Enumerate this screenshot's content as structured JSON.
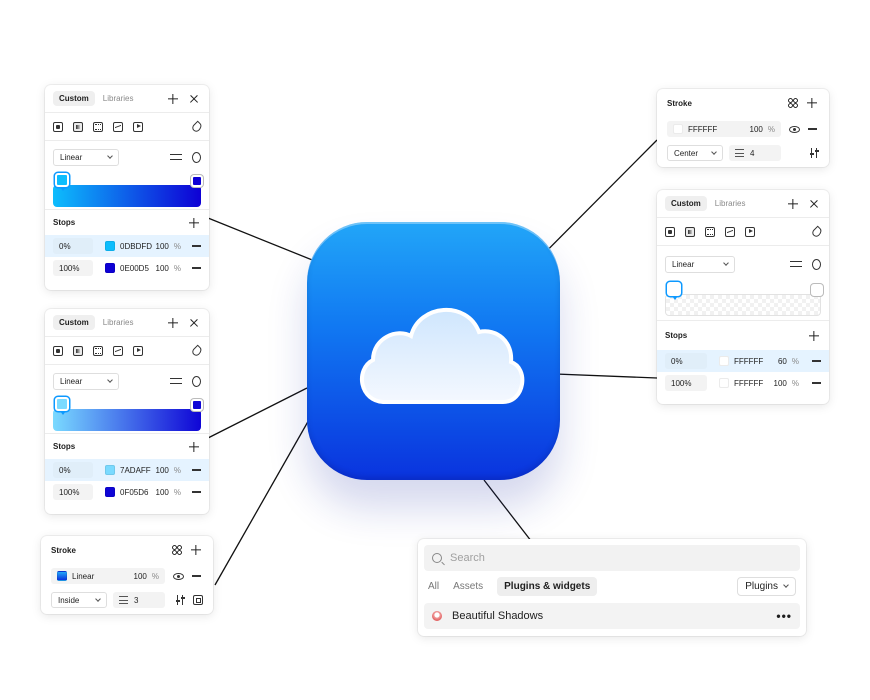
{
  "panel_fill_top": {
    "tabs": [
      "Custom",
      "Libraries"
    ],
    "type": "Linear",
    "stops_label": "Stops",
    "stops": [
      {
        "pos": "0%",
        "hex": "0DBDFD",
        "color": "#0DBDFD",
        "opacity": "100",
        "unit": "%"
      },
      {
        "pos": "100%",
        "hex": "0E00D5",
        "color": "#0E00D5",
        "opacity": "100",
        "unit": "%"
      }
    ],
    "gradient": [
      "#0DBDFD",
      "#0E00D5"
    ]
  },
  "panel_fill_mid": {
    "tabs": [
      "Custom",
      "Libraries"
    ],
    "type": "Linear",
    "stops_label": "Stops",
    "stops": [
      {
        "pos": "0%",
        "hex": "7ADAFF",
        "color": "#7ADAFF",
        "opacity": "100",
        "unit": "%"
      },
      {
        "pos": "100%",
        "hex": "0F05D6",
        "color": "#0F05D6",
        "opacity": "100",
        "unit": "%"
      }
    ],
    "gradient": [
      "#7ADAFF",
      "#0F05D6"
    ]
  },
  "panel_stroke_left": {
    "title": "Stroke",
    "fill_label": "Linear",
    "opacity": "100",
    "unit": "%",
    "position": "Inside",
    "weight": "3"
  },
  "panel_stroke_right": {
    "title": "Stroke",
    "hex": "FFFFFF",
    "opacity": "100",
    "unit": "%",
    "position": "Center",
    "weight": "4"
  },
  "panel_fill_right": {
    "tabs": [
      "Custom",
      "Libraries"
    ],
    "type": "Linear",
    "stops_label": "Stops",
    "stops": [
      {
        "pos": "0%",
        "hex": "FFFFFF",
        "color": "#FFFFFF",
        "opacity": "60",
        "unit": "%"
      },
      {
        "pos": "100%",
        "hex": "FFFFFF",
        "color": "#FFFFFF",
        "opacity": "100",
        "unit": "%"
      }
    ]
  },
  "search_panel": {
    "placeholder": "Search",
    "filters": [
      "All",
      "Assets",
      "Plugins & widgets"
    ],
    "dropdown": "Plugins",
    "result": "Beautiful Shadows",
    "more": "•••"
  },
  "colors": {
    "accent": "#0D99FF",
    "icon_top": "#22A6F8",
    "icon_bottom": "#0A33DE"
  }
}
